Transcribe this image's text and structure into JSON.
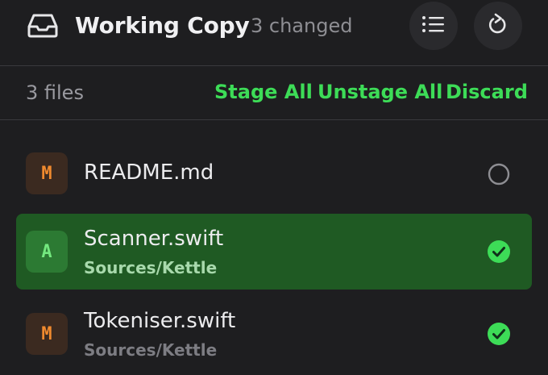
{
  "header": {
    "title": "Working Copy",
    "changed_label": "3 changed",
    "icons": {
      "tray": "tray-icon",
      "list": "list-icon",
      "refresh": "refresh-icon"
    }
  },
  "toolbar": {
    "file_count": "3 files",
    "stage_all": "Stage All",
    "unstage_all": "Unstage All",
    "discard": "Discard"
  },
  "files": [
    {
      "status": "M",
      "name": "README.md",
      "path": "",
      "staged": false,
      "selected": false
    },
    {
      "status": "A",
      "name": "Scanner.swift",
      "path": "Sources/Kettle",
      "staged": true,
      "selected": true
    },
    {
      "status": "M",
      "name": "Tokeniser.swift",
      "path": "Sources/Kettle",
      "staged": true,
      "selected": false
    }
  ],
  "colors": {
    "accent": "#3ddc57",
    "modified": "#f08a2e",
    "added": "#74e87f",
    "selected_row": "#1f5a23",
    "background": "#1e1e20"
  }
}
